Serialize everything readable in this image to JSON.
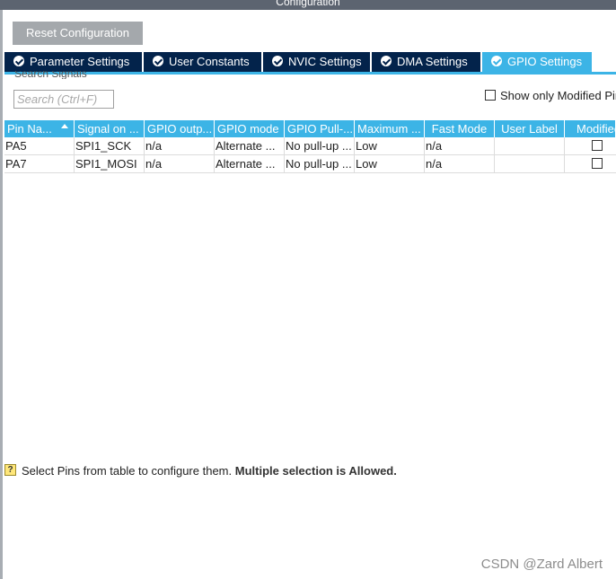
{
  "window": {
    "title": "Configuration"
  },
  "toolbar": {
    "reset_label": "Reset Configuration"
  },
  "tabs": [
    {
      "label": "Parameter Settings",
      "active": false
    },
    {
      "label": "User Constants",
      "active": false
    },
    {
      "label": "NVIC Settings",
      "active": false
    },
    {
      "label": "DMA Settings",
      "active": false
    },
    {
      "label": "GPIO Settings",
      "active": true
    }
  ],
  "search": {
    "label": "Search Signals",
    "placeholder": "Search (Ctrl+F)",
    "value": ""
  },
  "filter": {
    "show_modified_label": "Show only Modified Pin",
    "checked": false
  },
  "table": {
    "columns": [
      "Pin Na...",
      "Signal on ...",
      "GPIO outp...",
      "GPIO mode",
      "GPIO Pull-...",
      "Maximum ...",
      "Fast Mode",
      "User Label",
      "Modified"
    ],
    "rows": [
      [
        "PA5",
        "SPI1_SCK",
        "n/a",
        "Alternate ...",
        "No pull-up ...",
        "Low",
        "n/a",
        "",
        ""
      ],
      [
        "PA7",
        "SPI1_MOSI",
        "n/a",
        "Alternate ...",
        "No pull-up ...",
        "Low",
        "n/a",
        "",
        ""
      ]
    ]
  },
  "hint": {
    "icon": "help-icon",
    "text": "Select Pins from table to configure them.",
    "emphasis": "Multiple selection is Allowed."
  },
  "watermark": "CSDN @Zard Albert",
  "colors": {
    "accent": "#3cb4e6",
    "tab_dark": "#03234b",
    "button_gray": "#a4a8ac"
  }
}
